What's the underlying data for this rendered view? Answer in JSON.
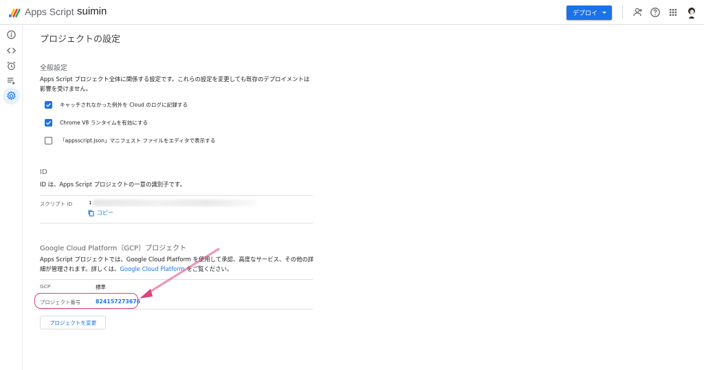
{
  "header": {
    "app_title": "Apps Script",
    "project_name": "suimin",
    "deploy_label": "デプロイ",
    "icons": [
      "add-person-icon",
      "help-icon",
      "apps-grid-icon",
      "avatar"
    ]
  },
  "sidebar": {
    "items": [
      {
        "name": "overview",
        "icon": "info-icon"
      },
      {
        "name": "editor",
        "icon": "code-icon"
      },
      {
        "name": "triggers",
        "icon": "alarm-icon"
      },
      {
        "name": "executions",
        "icon": "executions-icon"
      },
      {
        "name": "settings",
        "icon": "gear-icon",
        "active": true
      }
    ]
  },
  "settings": {
    "page_title": "プロジェクトの設定",
    "general": {
      "title": "全般設定",
      "description": "Apps Script プロジェクト全体に関係する設定です。これらの設定を変更しても既存のデプロイメントは影響を受けません。",
      "checkboxes": [
        {
          "label": "キャッチされなかった例外を Cloud のログに記録する",
          "checked": true
        },
        {
          "label": "Chrome V8 ランタイムを有効にする",
          "checked": true
        },
        {
          "label": "「appsscript.json」マニフェスト ファイルをエディタで表示する",
          "checked": false
        }
      ]
    },
    "id_section": {
      "title": "ID",
      "description": "ID は、Apps Script プロジェクトの一意の識別子です。",
      "script_id_label": "スクリプト ID",
      "script_id_prefix": "1",
      "copy_label": "コピー"
    },
    "gcp": {
      "title": "Google Cloud Platform（GCP）プロジェクト",
      "description_part1": "Apps Script プロジェクトでは、Google Cloud Platform を使用して承認、高度なサービス、その他の詳細が管理されます。詳しくは、",
      "link_text": "Google Cloud Platform",
      "description_part2": " をご覧ください。",
      "gcp_label": "GCP",
      "gcp_value": "標準",
      "project_number_label": "プロジェクト番号",
      "project_number": "824157273676",
      "change_button": "プロジェクトを変更"
    }
  },
  "colors": {
    "accent": "#1a73e8",
    "highlight": "#e0407b"
  }
}
